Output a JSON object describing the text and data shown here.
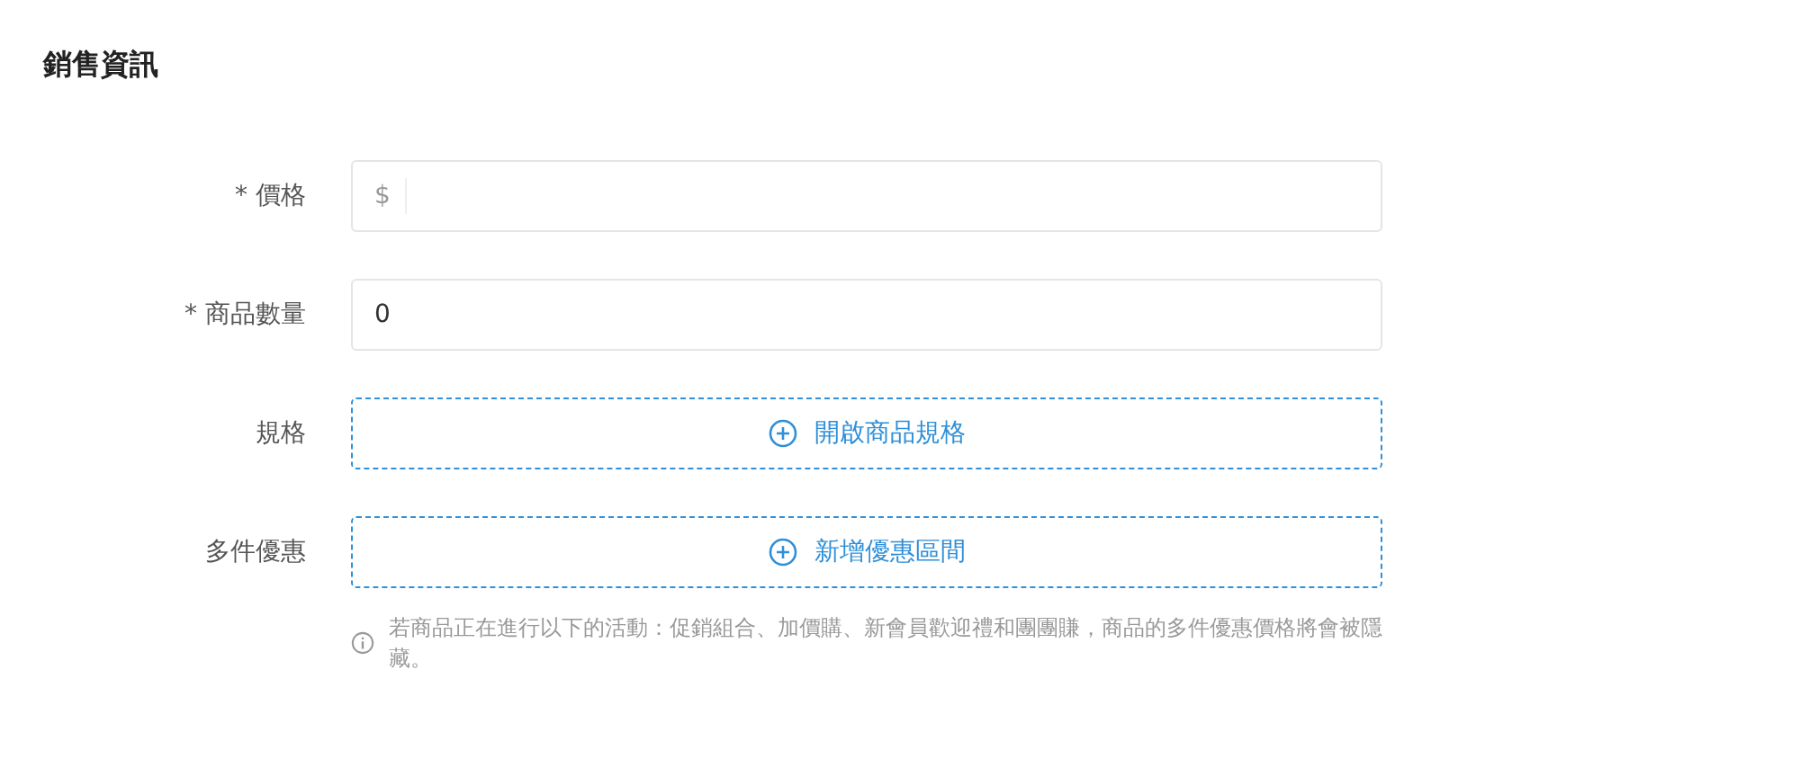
{
  "section": {
    "title": "銷售資訊"
  },
  "rows": [
    {
      "kind": "input",
      "label": "* 價格",
      "prefix": "$",
      "value": ""
    },
    {
      "kind": "input",
      "label": "* 商品數量",
      "value": "0"
    },
    {
      "kind": "add",
      "label": "規格",
      "button": "開啟商品規格"
    },
    {
      "kind": "add",
      "label": "多件優惠",
      "button": "新增優惠區間"
    }
  ],
  "note": "若商品正在進行以下的活動：促銷組合、加價購、新會員歡迎禮和團團賺，商品的多件優惠價格將會被隱藏。"
}
